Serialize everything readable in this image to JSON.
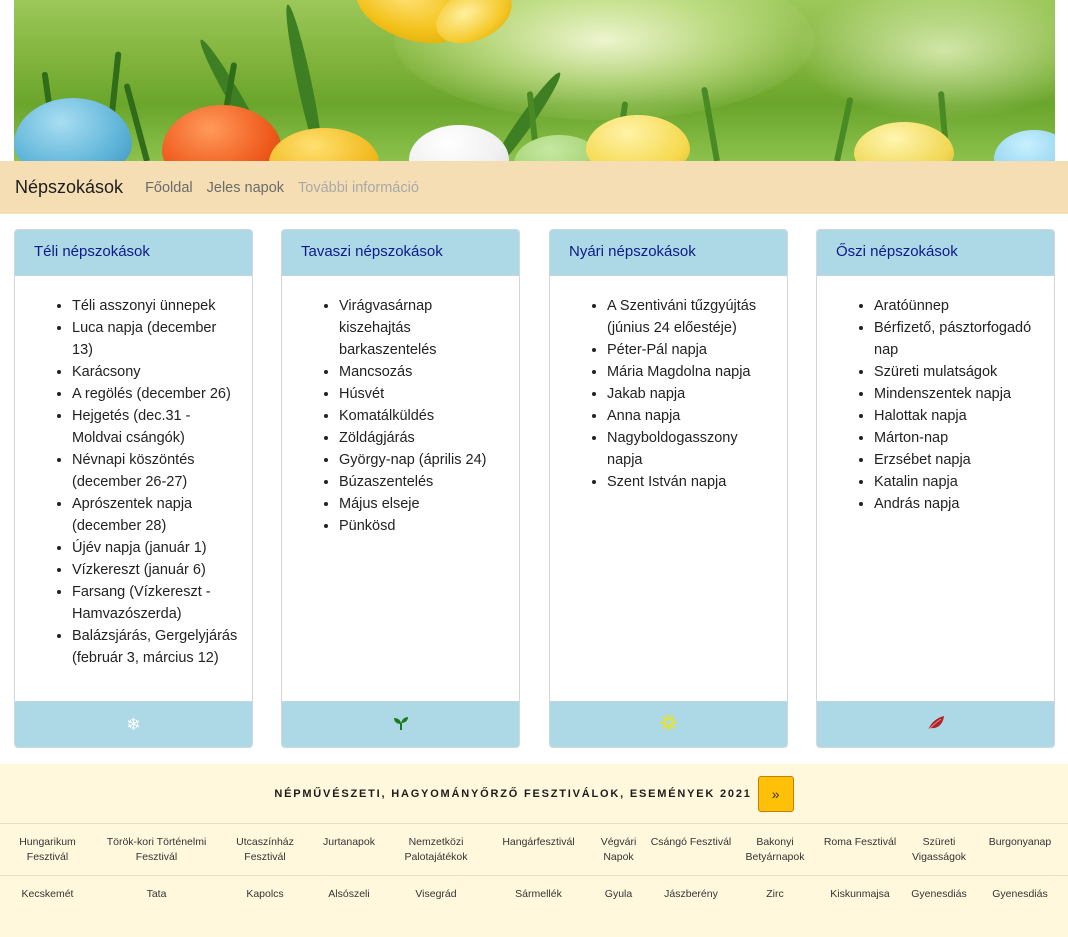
{
  "navbar": {
    "brand": "Népszokások",
    "links": [
      {
        "label": "Főoldal",
        "disabled": false
      },
      {
        "label": "Jeles napok",
        "disabled": false
      },
      {
        "label": "További információ",
        "disabled": true
      }
    ]
  },
  "cards": [
    {
      "title": "Téli népszokások",
      "items": [
        "Téli asszonyi ünnepek",
        "Luca napja (december 13)",
        "Karácsony",
        "A regölés (december 26)",
        "Hejgetés (dec.31 - Moldvai csángók)",
        "Névnapi köszöntés (december 26-27)",
        "Aprószentek napja (december 28)",
        "Újév napja (január 1)",
        "Vízkereszt (január 6)",
        "Farsang (Vízkereszt - Hamvazószerda)",
        "Balázsjárás, Gergelyjárás (február 3, március 12)"
      ],
      "icon": "snowflake-icon",
      "icon_glyph": "❄",
      "icon_color": "#ffffff"
    },
    {
      "title": "Tavaszi népszokások",
      "items": [
        "Virágvasárnap kiszehajtás barkaszentelés",
        "Mancsozás",
        "Húsvét",
        "Komatálküldés",
        "Zöldágjárás",
        "György-nap (április 24)",
        "Búzaszentelés",
        "Május elseje",
        "Pünkösd"
      ],
      "icon": "seedling-icon",
      "icon_glyph": "",
      "icon_color": "#1f7a1f"
    },
    {
      "title": "Nyári népszokások",
      "items": [
        "A Szentiváni tűzgyújtás (június 24 előestéje)",
        "Péter-Pál napja",
        "Mária Magdolna napja",
        "Jakab napja",
        "Anna napja",
        "Nagyboldogasszony napja",
        "Szent István napja"
      ],
      "icon": "sun-icon",
      "icon_glyph": "☼",
      "icon_color": "#f2e600"
    },
    {
      "title": "Őszi népszokások",
      "items": [
        "Aratóünnep",
        "Bérfizető, pásztorfogadó nap",
        "Szüreti mulatságok",
        "Mindenszentek napja",
        "Halottak napja",
        "Márton-nap",
        "Erzsébet napja",
        "Katalin napja",
        "András napja"
      ],
      "icon": "leaf-icon",
      "icon_glyph": "",
      "icon_color": "#b22222"
    }
  ],
  "festivals": {
    "title": "NÉPMŰVÉSZETI, HAGYOMÁNYŐRZŐ FESZTIVÁLOK, ESEMÉNYEK 2021",
    "more_label": "»",
    "events": [
      "Hungarikum Fesztivál",
      "Török-kori Történelmi Fesztivál",
      "Utcaszínház Fesztivál",
      "Jurtanapok",
      "Nemzetközi Palotajátékok",
      "Hangárfesztivál",
      "Végvári Napok",
      "Csángó Fesztivál",
      "Bakonyi Betyárnapok",
      "Roma Fesztivál",
      "Szüreti Vigasságok",
      "Burgonyanap"
    ],
    "places": [
      "Kecskemét",
      "Tata",
      "Kapolcs",
      "Alsószeli",
      "Visegrád",
      "Sármellék",
      "Gyula",
      "Jászberény",
      "Zirc",
      "Kiskunmajsa",
      "Gyenesdiás",
      "Gyenesdiás"
    ]
  }
}
